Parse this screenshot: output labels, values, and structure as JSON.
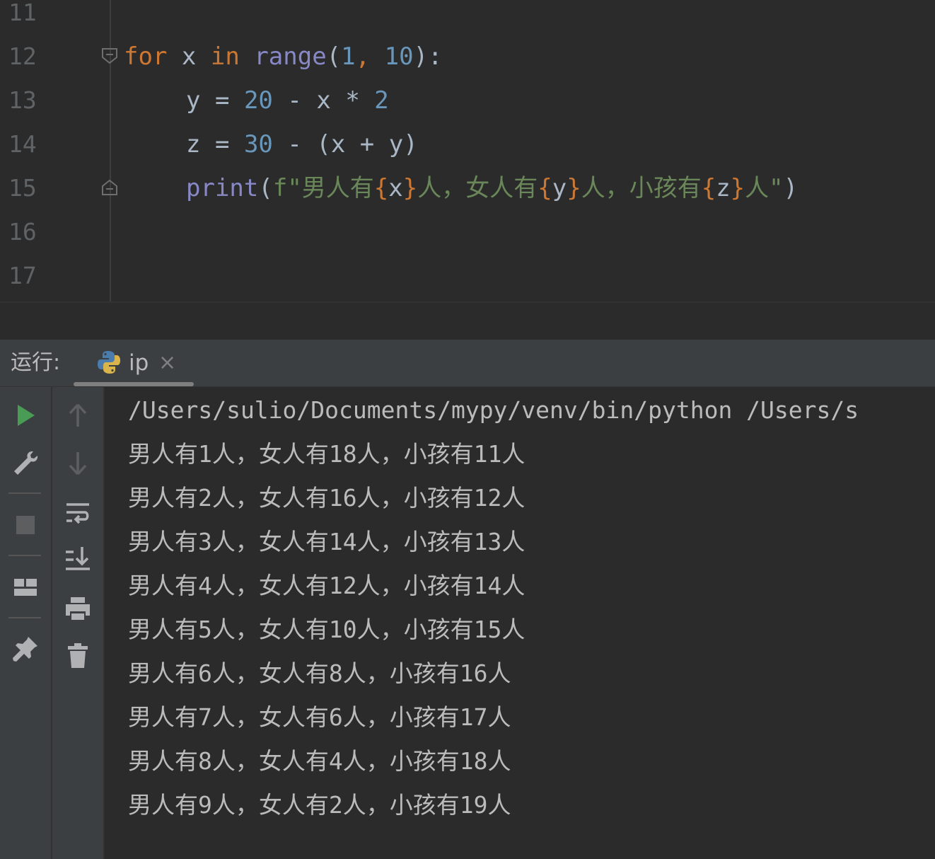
{
  "editor": {
    "lines": [
      {
        "num": "11"
      },
      {
        "num": "12"
      },
      {
        "num": "13"
      },
      {
        "num": "14"
      },
      {
        "num": "15"
      },
      {
        "num": "16"
      },
      {
        "num": "17"
      }
    ],
    "code": {
      "l12": {
        "kw_for": "for",
        "var_x": "x",
        "kw_in": "in",
        "fn_range": "range",
        "p_open": "(",
        "n1": "1",
        "comma": ",",
        "n10": "10",
        "p_close": "):"
      },
      "l13": {
        "var_y": "y",
        "eq": "=",
        "n20": "20",
        "minus": "-",
        "var_x": "x",
        "mul": "*",
        "n2": "2"
      },
      "l14": {
        "var_z": "z",
        "eq": "=",
        "n30": "30",
        "minus": "-",
        "paren_x": "(x",
        "plus": "+",
        "y_paren": "y)"
      },
      "l15": {
        "fn_print": "print",
        "p_open": "(",
        "s_start": "f\"男人有",
        "b1o": "{",
        "v1": "x",
        "b1c": "}",
        "s_mid1": "人，女人有",
        "b2o": "{",
        "v2": "y",
        "b2c": "}",
        "s_mid2": "人，小孩有",
        "b3o": "{",
        "v3": "z",
        "b3c": "}",
        "s_end": "人\"",
        "p_close": ")"
      }
    }
  },
  "run_panel": {
    "label": "运行:",
    "tab": {
      "name": "ip",
      "close": "×",
      "icon": "python-icon"
    }
  },
  "toolbar_left": [
    "run-icon",
    "wrench-icon",
    "stop-icon",
    "layout-icon",
    "pin-icon"
  ],
  "toolbar_right": [
    "arrow-up-icon",
    "arrow-down-icon",
    "soft-wrap-icon",
    "scroll-to-end-icon",
    "print-icon",
    "trash-icon"
  ],
  "console": {
    "lines": [
      "/Users/sulio/Documents/mypy/venv/bin/python /Users/s",
      "男人有1人，女人有18人，小孩有11人",
      "男人有2人，女人有16人，小孩有12人",
      "男人有3人，女人有14人，小孩有13人",
      "男人有4人，女人有12人，小孩有14人",
      "男人有5人，女人有10人，小孩有15人",
      "男人有6人，女人有8人，小孩有16人",
      "男人有7人，女人有6人，小孩有17人",
      "男人有8人，女人有4人，小孩有18人",
      "男人有9人，女人有2人，小孩有19人"
    ]
  },
  "colors": {
    "keyword": "#cc7832",
    "builtin": "#8888c6",
    "number": "#6897bb",
    "string": "#6a8759",
    "run_green": "#499c54"
  }
}
